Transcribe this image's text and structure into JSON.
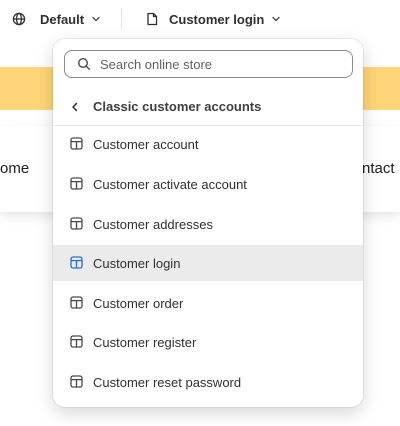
{
  "topbar": {
    "theme_label": "Default",
    "template_label": "Customer login"
  },
  "preview": {
    "nav_left_text": "ome",
    "nav_right_text": "ntact"
  },
  "dropdown": {
    "search_placeholder": "Search online store",
    "section_title": "Classic customer accounts",
    "items": [
      {
        "label": "Customer account"
      },
      {
        "label": "Customer activate account"
      },
      {
        "label": "Customer addresses"
      },
      {
        "label": "Customer login",
        "selected": true
      },
      {
        "label": "Customer order"
      },
      {
        "label": "Customer register"
      },
      {
        "label": "Customer reset password"
      }
    ]
  },
  "colors": {
    "accent_yellow": "#ffd57a",
    "selected_bg": "#ebebeb",
    "selected_icon": "#2c6ecb",
    "icon": "#4a4a4a"
  },
  "icons": {
    "theme": "globe-icon",
    "template": "page-icon",
    "dropdown_caret": "chevron-down-icon",
    "search": "search-icon",
    "back": "chevron-left-icon",
    "item": "layout-template-icon"
  }
}
